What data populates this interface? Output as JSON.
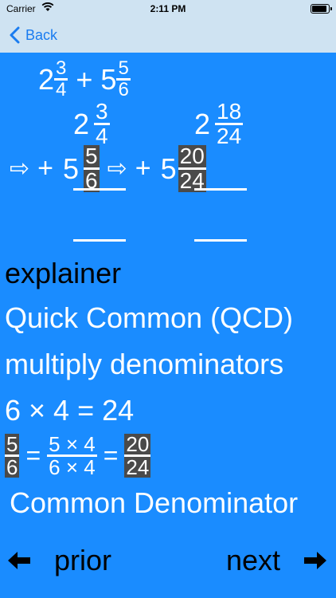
{
  "status": {
    "carrier": "Carrier",
    "time": "2:11 PM"
  },
  "nav": {
    "back_label": "Back"
  },
  "problem": {
    "a_whole": "2",
    "a_num": "3",
    "a_den": "4",
    "op": "+",
    "b_whole": "5",
    "b_num": "5",
    "b_den": "6"
  },
  "work": {
    "top_left_whole": "2",
    "top_left_num": "3",
    "top_left_den": "4",
    "top_right_whole": "2",
    "top_right_num": "18",
    "top_right_den": "24",
    "arrow": "⇨",
    "plus": "+",
    "bottom_left_whole": "5",
    "bottom_left_num": "5",
    "bottom_left_den": "6",
    "bottom_right_whole": "5",
    "bottom_right_num": "20",
    "bottom_right_den": "24"
  },
  "explainer": {
    "title": "explainer",
    "line1": "Quick Common (QCD)",
    "line2": "multiply denominators",
    "line3": "6 × 4 = 24"
  },
  "equation": {
    "f1_num": "5",
    "f1_den": "6",
    "eq1": "=",
    "f2_num": "5 × 4",
    "f2_den": "6 × 4",
    "eq2": "=",
    "f3_num": "20",
    "f3_den": "24"
  },
  "footer_text": "Common Denominator",
  "bottom_nav": {
    "prior_label": "prior",
    "next_label": "next"
  }
}
